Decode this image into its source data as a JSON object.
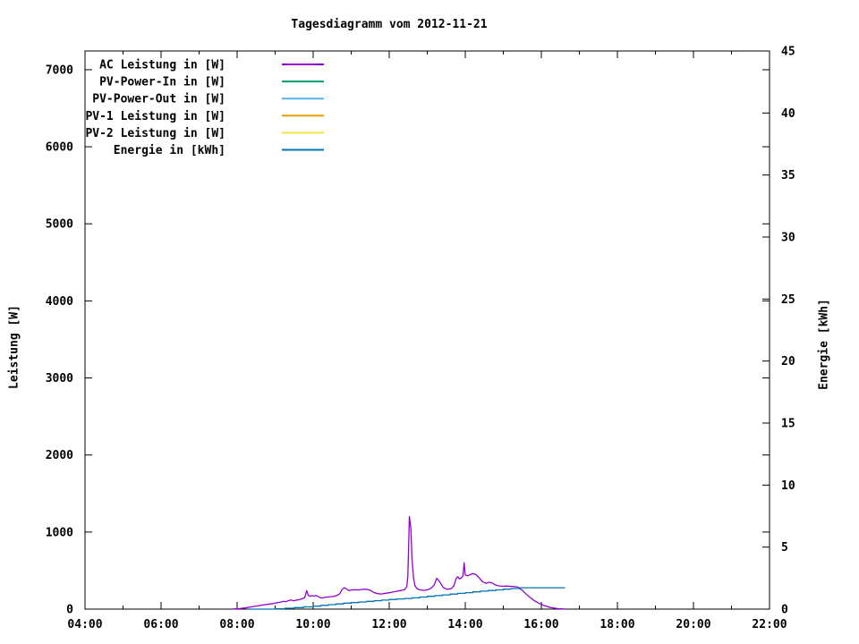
{
  "title": "Tagesdiagramm vom 2012-11-21",
  "axes": {
    "y_left": {
      "label": "Leistung [W]",
      "ticks": [
        {
          "value": 0,
          "label": "0"
        },
        {
          "value": 1000,
          "label": "1000"
        },
        {
          "value": 2000,
          "label": "2000"
        },
        {
          "value": 3000,
          "label": "3000"
        },
        {
          "value": 4000,
          "label": "4000"
        },
        {
          "value": 5000,
          "label": "5000"
        },
        {
          "value": 6000,
          "label": "6000"
        },
        {
          "value": 7000,
          "label": "7000"
        }
      ]
    },
    "y_right": {
      "label": "Energie [kWh]",
      "ticks": [
        {
          "value": 0,
          "label": "0"
        },
        {
          "value": 5,
          "label": "5"
        },
        {
          "value": 10,
          "label": "10"
        },
        {
          "value": 15,
          "label": "15"
        },
        {
          "value": 20,
          "label": "20"
        },
        {
          "value": 25,
          "label": "25"
        },
        {
          "value": 30,
          "label": "30"
        },
        {
          "value": 35,
          "label": "35"
        },
        {
          "value": 40,
          "label": "40"
        },
        {
          "value": 45,
          "label": "45"
        }
      ]
    },
    "x": {
      "major_ticks": [
        {
          "hour": 4,
          "label": "04:00"
        },
        {
          "hour": 6,
          "label": "06:00"
        },
        {
          "hour": 8,
          "label": "08:00"
        },
        {
          "hour": 10,
          "label": "10:00"
        },
        {
          "hour": 12,
          "label": "12:00"
        },
        {
          "hour": 14,
          "label": "14:00"
        },
        {
          "hour": 16,
          "label": "16:00"
        },
        {
          "hour": 18,
          "label": "18:00"
        },
        {
          "hour": 20,
          "label": "20:00"
        },
        {
          "hour": 22,
          "label": "22:00"
        }
      ],
      "minor_hours": [
        5,
        7,
        9,
        11,
        13,
        15,
        17,
        19,
        21
      ]
    }
  },
  "legend": {
    "entries": [
      {
        "label": "AC Leistung in [W]",
        "color": "#9400d3"
      },
      {
        "label": "PV-Power-In in [W]",
        "color": "#009e73"
      },
      {
        "label": "PV-Power-Out in [W]",
        "color": "#56b4e9"
      },
      {
        "label": "PV-1 Leistung in [W]",
        "color": "#e69f00"
      },
      {
        "label": "PV-2 Leistung in [W]",
        "color": "#f0e442"
      },
      {
        "label": "Energie in [kWh]",
        "color": "#0072b2"
      }
    ]
  },
  "colors": {
    "background": "#ffffff",
    "border": "#000000",
    "text": "#000000"
  },
  "chart_data": {
    "type": "line",
    "title": "Tagesdiagramm vom 2012-11-21",
    "xlabel": "",
    "x_unit": "time of day (hours)",
    "x_range": [
      4,
      22
    ],
    "y_left_label": "Leistung [W]",
    "y_left_range": [
      0,
      7243
    ],
    "y_right_label": "Energie [kWh]",
    "y_right_range": [
      0,
      45
    ],
    "grid": false,
    "legend_position": "top-left-inside-no-box",
    "series": [
      {
        "name": "AC Leistung in [W]",
        "color": "#9400d3",
        "axis": "left",
        "style": "lines",
        "visible": true,
        "points": [
          [
            7.88,
            2
          ],
          [
            8.05,
            6
          ],
          [
            8.2,
            15
          ],
          [
            8.35,
            28
          ],
          [
            8.5,
            40
          ],
          [
            8.65,
            52
          ],
          [
            8.8,
            62
          ],
          [
            8.95,
            72
          ],
          [
            9.05,
            82
          ],
          [
            9.15,
            92
          ],
          [
            9.22,
            102
          ],
          [
            9.28,
            96
          ],
          [
            9.35,
            110
          ],
          [
            9.42,
            118
          ],
          [
            9.48,
            108
          ],
          [
            9.55,
            115
          ],
          [
            9.62,
            122
          ],
          [
            9.7,
            132
          ],
          [
            9.78,
            150
          ],
          [
            9.83,
            240
          ],
          [
            9.87,
            180
          ],
          [
            9.92,
            166
          ],
          [
            9.97,
            175
          ],
          [
            10.02,
            168
          ],
          [
            10.07,
            178
          ],
          [
            10.12,
            166
          ],
          [
            10.18,
            150
          ],
          [
            10.24,
            144
          ],
          [
            10.3,
            152
          ],
          [
            10.4,
            158
          ],
          [
            10.5,
            162
          ],
          [
            10.6,
            172
          ],
          [
            10.7,
            200
          ],
          [
            10.76,
            255
          ],
          [
            10.82,
            278
          ],
          [
            10.88,
            260
          ],
          [
            10.94,
            240
          ],
          [
            11.0,
            248
          ],
          [
            11.1,
            252
          ],
          [
            11.2,
            248
          ],
          [
            11.3,
            256
          ],
          [
            11.4,
            258
          ],
          [
            11.5,
            245
          ],
          [
            11.6,
            215
          ],
          [
            11.7,
            200
          ],
          [
            11.8,
            196
          ],
          [
            11.9,
            206
          ],
          [
            12.0,
            212
          ],
          [
            12.1,
            222
          ],
          [
            12.2,
            232
          ],
          [
            12.3,
            242
          ],
          [
            12.4,
            252
          ],
          [
            12.46,
            290
          ],
          [
            12.49,
            430
          ],
          [
            12.51,
            820
          ],
          [
            12.53,
            1200
          ],
          [
            12.55,
            1120
          ],
          [
            12.57,
            1040
          ],
          [
            12.6,
            640
          ],
          [
            12.64,
            400
          ],
          [
            12.68,
            300
          ],
          [
            12.74,
            262
          ],
          [
            12.82,
            250
          ],
          [
            12.9,
            244
          ],
          [
            13.0,
            250
          ],
          [
            13.1,
            270
          ],
          [
            13.18,
            312
          ],
          [
            13.25,
            400
          ],
          [
            13.32,
            360
          ],
          [
            13.42,
            282
          ],
          [
            13.52,
            256
          ],
          [
            13.62,
            264
          ],
          [
            13.7,
            302
          ],
          [
            13.76,
            398
          ],
          [
            13.8,
            420
          ],
          [
            13.85,
            392
          ],
          [
            13.9,
            406
          ],
          [
            13.94,
            432
          ],
          [
            13.97,
            600
          ],
          [
            14.0,
            442
          ],
          [
            14.06,
            432
          ],
          [
            14.12,
            446
          ],
          [
            14.2,
            462
          ],
          [
            14.28,
            448
          ],
          [
            14.36,
            410
          ],
          [
            14.45,
            356
          ],
          [
            14.55,
            336
          ],
          [
            14.62,
            348
          ],
          [
            14.7,
            342
          ],
          [
            14.78,
            316
          ],
          [
            14.88,
            302
          ],
          [
            14.98,
            296
          ],
          [
            15.08,
            300
          ],
          [
            15.18,
            296
          ],
          [
            15.28,
            292
          ],
          [
            15.38,
            285
          ],
          [
            15.48,
            252
          ],
          [
            15.58,
            205
          ],
          [
            15.7,
            152
          ],
          [
            15.82,
            108
          ],
          [
            15.95,
            72
          ],
          [
            16.08,
            45
          ],
          [
            16.2,
            26
          ],
          [
            16.33,
            14
          ],
          [
            16.45,
            6
          ],
          [
            16.6,
            2
          ]
        ]
      },
      {
        "name": "PV-Power-In in [W]",
        "color": "#009e73",
        "axis": "left",
        "style": "lines",
        "visible": false,
        "points": []
      },
      {
        "name": "PV-Power-Out in [W]",
        "color": "#56b4e9",
        "axis": "left",
        "style": "lines",
        "visible": false,
        "points": []
      },
      {
        "name": "PV-1 Leistung in [W]",
        "color": "#e69f00",
        "axis": "left",
        "style": "lines",
        "visible": false,
        "points": []
      },
      {
        "name": "PV-2 Leistung in [W]",
        "color": "#f0e442",
        "axis": "left",
        "style": "lines",
        "visible": false,
        "points": []
      },
      {
        "name": "Energie in [kWh]",
        "color": "#0072b2",
        "axis": "right",
        "style": "steps",
        "visible": true,
        "points": [
          [
            8.3,
            0
          ],
          [
            9.0,
            0.03
          ],
          [
            9.25,
            0.07
          ],
          [
            9.5,
            0.12
          ],
          [
            9.75,
            0.18
          ],
          [
            10.0,
            0.24
          ],
          [
            10.2,
            0.3
          ],
          [
            10.4,
            0.36
          ],
          [
            10.6,
            0.42
          ],
          [
            10.8,
            0.48
          ],
          [
            11.0,
            0.53
          ],
          [
            11.2,
            0.58
          ],
          [
            11.4,
            0.63
          ],
          [
            11.6,
            0.68
          ],
          [
            11.8,
            0.73
          ],
          [
            12.0,
            0.78
          ],
          [
            12.2,
            0.82
          ],
          [
            12.4,
            0.86
          ],
          [
            12.6,
            0.91
          ],
          [
            12.8,
            0.97
          ],
          [
            13.0,
            1.03
          ],
          [
            13.2,
            1.09
          ],
          [
            13.4,
            1.15
          ],
          [
            13.6,
            1.21
          ],
          [
            13.8,
            1.27
          ],
          [
            14.0,
            1.33
          ],
          [
            14.2,
            1.39
          ],
          [
            14.4,
            1.45
          ],
          [
            14.6,
            1.5
          ],
          [
            14.8,
            1.55
          ],
          [
            15.0,
            1.61
          ],
          [
            15.2,
            1.66
          ],
          [
            15.42,
            1.72
          ],
          [
            16.62,
            1.72
          ]
        ]
      }
    ]
  }
}
